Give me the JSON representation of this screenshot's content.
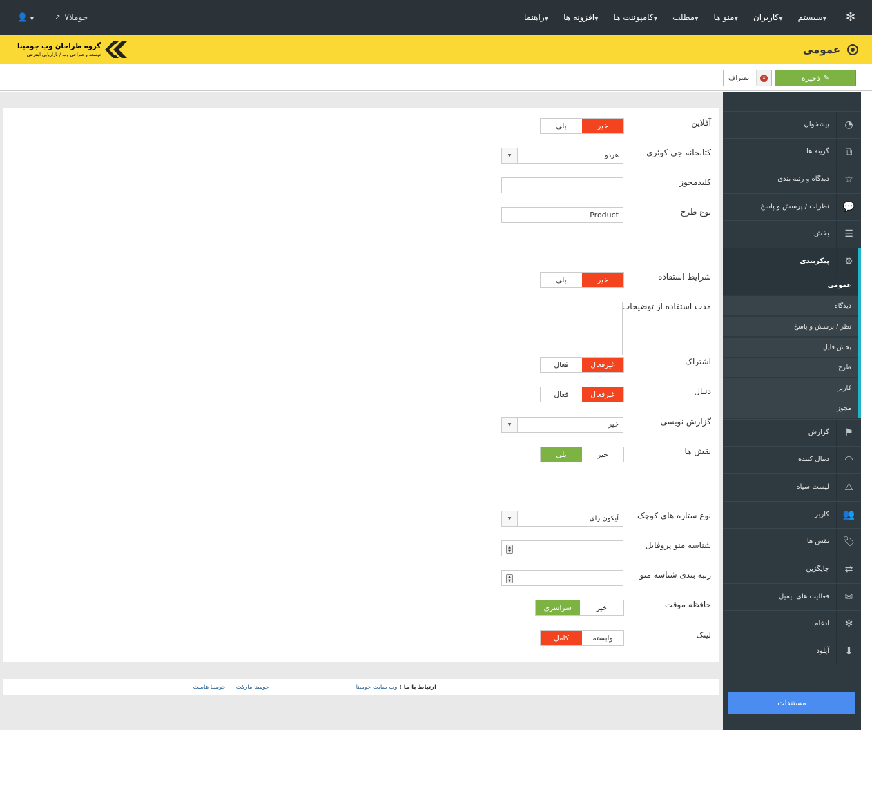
{
  "topbar": {
    "menu": [
      "سیستم",
      "کاربران",
      "منو ها",
      "مطلب",
      "کامپوننت ها",
      "افزونه ها",
      "راهنما"
    ],
    "site_link": "جوملا۷"
  },
  "header": {
    "title": "عمومی",
    "brand_main": "گروه طراحان وب جومینا",
    "brand_sub": "توسعه و طراحی وب / بازاریابی اینترنتی"
  },
  "toolbar": {
    "save_label": "ذخیره",
    "cancel_label": "انصراف"
  },
  "form": {
    "offline": {
      "label": "آفلاین",
      "opt_no": "خیر",
      "opt_yes": "بلی"
    },
    "jquery": {
      "label": "کتابخانه جی کوئری",
      "value": "هردو"
    },
    "license_key": {
      "label": "کلیدمجوز",
      "value": ""
    },
    "layout_type": {
      "label": "نوع طرح",
      "value": "Product"
    },
    "terms": {
      "label": "شرایط استفاده",
      "opt_no": "خیر",
      "opt_yes": "بلی"
    },
    "terms_duration": {
      "label": "مدت استفاده از توضیحات"
    },
    "share": {
      "label": "اشتراک",
      "opt_off": "غیرفعال",
      "opt_on": "فعال"
    },
    "follow": {
      "label": "دنبال",
      "opt_off": "غیرفعال",
      "opt_on": "فعال"
    },
    "logging": {
      "label": "گزارش نویسی",
      "value": "خیر"
    },
    "roles": {
      "label": "نقش ها",
      "opt_no": "خیر",
      "opt_yes": "بلی"
    },
    "star_type": {
      "label": "نوع ستاره های کوچک",
      "value": "آیکون رای"
    },
    "profile_menu_id": {
      "label": "شناسه منو پروفایل"
    },
    "menu_id_ranking": {
      "label": "رتبه بندی شناسه منو"
    },
    "cache": {
      "label": "حافظه موقت",
      "opt_no": "خیر",
      "opt_global": "سراسری"
    },
    "link": {
      "label": "لینک",
      "opt_relative": "وابسته",
      "opt_full": "کامل"
    }
  },
  "footer": {
    "contact_prefix": "ارتباط با ما :",
    "contact_link": "وب سایت جومینا",
    "links": [
      "جومینا مارکت",
      "جومینا هاست"
    ]
  },
  "sidebar": {
    "items": [
      {
        "label": "پیشخوان",
        "icon": "dashboard-icon"
      },
      {
        "label": "گزینه ها",
        "icon": "copy-icon"
      },
      {
        "label": "دیدگاه و رتبه بندی",
        "icon": "star-icon"
      },
      {
        "label": "نظرات / پرسش و پاسخ",
        "icon": "comments-icon"
      },
      {
        "label": "بخش",
        "icon": "list-icon"
      },
      {
        "label": "پیکربندی",
        "icon": "cogs-icon"
      }
    ],
    "subitems": [
      "عمومی",
      "دیدگاه",
      "نظر / پرسش و پاسخ",
      "بخش فایل",
      "طرح",
      "کاربر",
      "مجوز"
    ],
    "items_after": [
      {
        "label": "گزارش",
        "icon": "flag-icon"
      },
      {
        "label": "دنبال کننده",
        "icon": "rss-icon"
      },
      {
        "label": "لیست سیاه",
        "icon": "warning-icon"
      },
      {
        "label": "کاربر",
        "icon": "users-icon"
      },
      {
        "label": "نقش ها",
        "icon": "tag-icon"
      },
      {
        "label": "جایگزین",
        "icon": "exchange-icon"
      },
      {
        "label": "فعالیت های ایمیل",
        "icon": "envelope-icon"
      },
      {
        "label": "ادغام",
        "icon": "joomla-icon"
      },
      {
        "label": "آپلود",
        "icon": "download-icon"
      }
    ],
    "docs_button": "مستندات"
  },
  "colors": {
    "topbar": "#2c3338",
    "header": "#fbd935",
    "save": "#7cb342",
    "toggle_red": "#f4431f",
    "toggle_green": "#7cb342",
    "sidebar": "#2e3a40",
    "sidebar_accent": "#1fb6cc",
    "docs_button": "#4a8cf0"
  }
}
